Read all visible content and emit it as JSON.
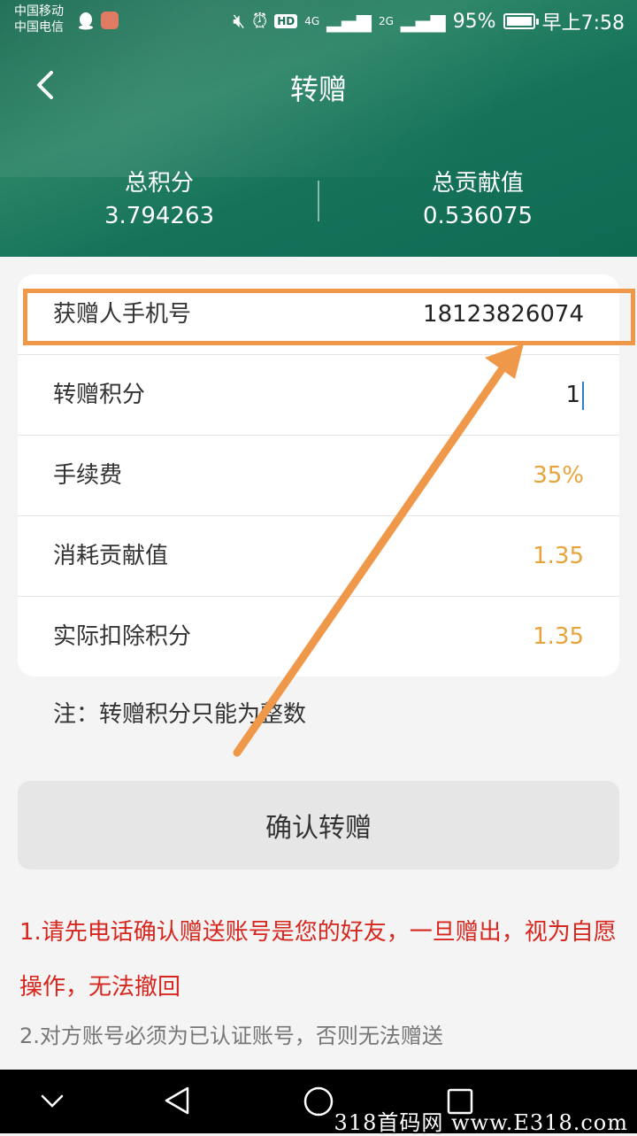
{
  "status": {
    "carrier1": "中国移动",
    "carrier2": "中国电信",
    "network1": "4G",
    "network2": "2G",
    "battery": "95%",
    "time": "早上7:58"
  },
  "header": {
    "title": "转赠",
    "total_points_label": "总积分",
    "total_points_value": "3.794263",
    "total_contribution_label": "总贡献值",
    "total_contribution_value": "0.536075"
  },
  "form": {
    "recipient_label": "获赠人手机号",
    "recipient_value": "18123826074",
    "gift_points_label": "转赠积分",
    "gift_points_value": "1",
    "fee_label": "手续费",
    "fee_value": "35%",
    "consume_label": "消耗贡献值",
    "consume_value": "1.35",
    "deduct_label": "实际扣除积分",
    "deduct_value": "1.35"
  },
  "note": "注：转赠积分只能为整数",
  "confirm_label": "确认转赠",
  "tips": {
    "tip1": "1.请先电话确认赠送账号是您的好友，一旦赠出，视为自愿操作，无法撤回",
    "tip2": "2.对方账号必须为已认证账号，否则无法赠送"
  },
  "watermark": "318首码网 www.E318.com",
  "colors": {
    "header_green": "#1e7a5c",
    "accent_orange": "#e8a33c",
    "warning_red": "#d7261e",
    "annotation_orange": "#f0984a"
  }
}
